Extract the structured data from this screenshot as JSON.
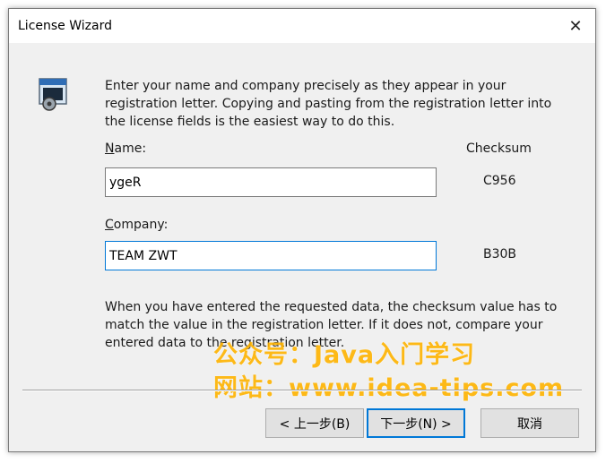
{
  "window": {
    "title": "License Wizard",
    "close_glyph": "✕"
  },
  "intro_text": "Enter your name and company precisely as they appear in your registration letter.  Copying and pasting from the registration letter into the license fields is the easiest way to do this.",
  "name": {
    "label_rest": "ame:",
    "label_accel": "N",
    "value": "ygeR",
    "checksum": "C956"
  },
  "company": {
    "label_rest": "ompany:",
    "label_accel": "C",
    "value": "TEAM ZWT",
    "checksum": "B30B"
  },
  "checksum_header": "Checksum",
  "note_text": "When you have entered the requested data, the checksum value has to match the value in the registration letter.  If it does not, compare your entered data to the registration letter.",
  "watermark": {
    "line1": "公众号：Java入门学习",
    "line2": "网站：www.idea-tips.com",
    "color": "#ffb400"
  },
  "buttons": {
    "back": "< 上一步(B)",
    "next": "下一步(N) >",
    "cancel": "取消"
  },
  "icons": {
    "wizard": "license-key-icon",
    "close": "close-icon"
  }
}
